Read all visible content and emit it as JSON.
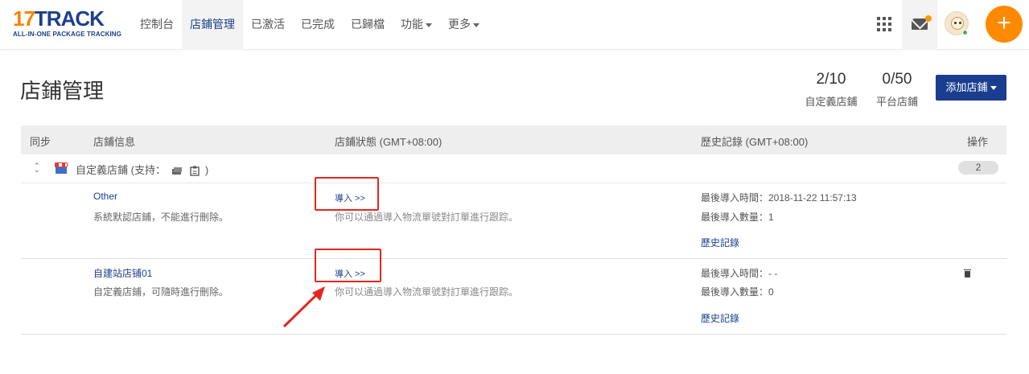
{
  "logo": {
    "num": "17",
    "track": "TRACK",
    "tagline": "ALL-IN-ONE PACKAGE TRACKING"
  },
  "nav": {
    "items": [
      {
        "label": "控制台"
      },
      {
        "label": "店鋪管理",
        "active": true
      },
      {
        "label": "已激活"
      },
      {
        "label": "已完成"
      },
      {
        "label": "已歸檔"
      },
      {
        "label": "功能",
        "dropdown": true
      },
      {
        "label": "更多",
        "dropdown": true
      }
    ],
    "icons": [
      "apps-grid-icon",
      "mail-icon",
      "avatar",
      "plus-icon"
    ],
    "fab_label": "+"
  },
  "page": {
    "title": "店鋪管理",
    "stats": [
      {
        "value": "2/10",
        "label": "自定義店鋪"
      },
      {
        "value": "0/50",
        "label": "平台店鋪"
      }
    ],
    "add_button": "添加店鋪"
  },
  "table": {
    "headers": {
      "sync": "同步",
      "info": "店鋪信息",
      "status": "店鋪狀態 (GMT+08:00)",
      "history": "歷史記錄 (GMT+08:00)",
      "actions": "操作"
    },
    "group": {
      "label_prefix": "自定義店鋪 (支持：",
      "label_suffix": ")",
      "count": "2"
    },
    "rows": [
      {
        "name": "Other",
        "desc": "系統默認店鋪，不能進行刪除。",
        "import_link": "導入 >>",
        "hint": "你可以通過導入物流單號對訂單進行跟踪。",
        "last_import_time": "最後導入時間：2018-11-22 11:57:13",
        "last_import_count": "最後導入數量：1",
        "history_link": "歷史記錄"
      },
      {
        "name": "自建站店铺01",
        "desc": "自定義店鋪，可隨時進行刪除。",
        "import_link": "導入 >>",
        "hint": "你可以通過導入物流單號對訂單進行跟踪。",
        "last_import_time": "最後導入時間：- -",
        "last_import_count": "最後導入數量：0",
        "history_link": "歷史記錄"
      }
    ]
  },
  "colors": {
    "brand_blue": "#1c3f8c",
    "brand_orange": "#ff8a00",
    "highlight_red": "#e5261f"
  }
}
